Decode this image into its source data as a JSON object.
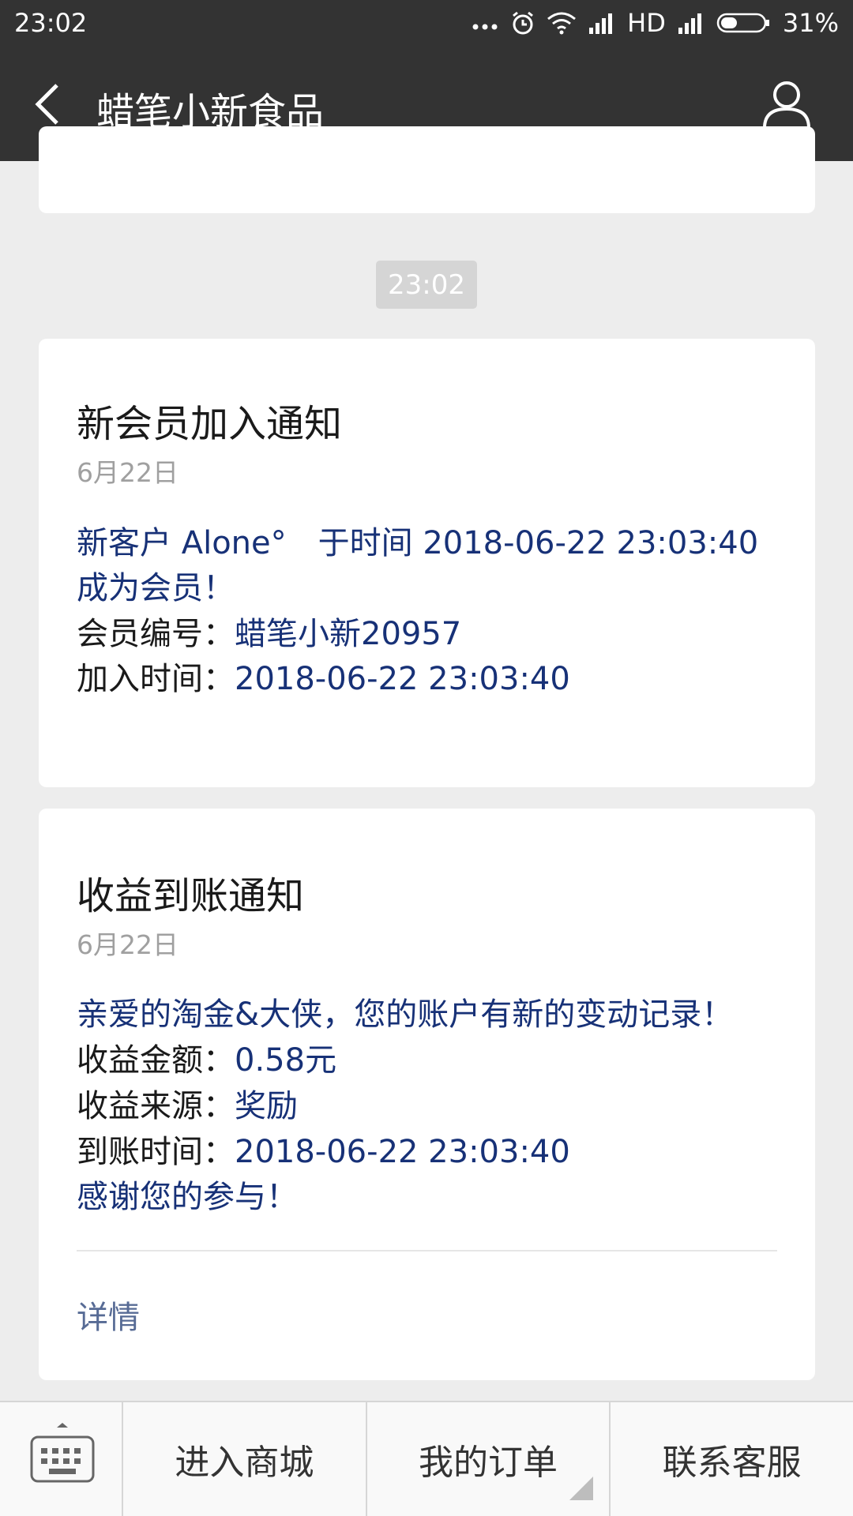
{
  "status_bar": {
    "time": "23:02",
    "network": "HD",
    "battery": "31%"
  },
  "header": {
    "title": "蜡笔小新食品"
  },
  "timestamp": "23:02",
  "cards": [
    {
      "title": "新会员加入通知",
      "date": "6月22日",
      "line1": "新客户 Alone°　于时间 2018-06-22 23:03:40",
      "line2": "成为会员！",
      "member_id_label": "会员编号：",
      "member_id_value": "蜡笔小新20957",
      "join_time_label": "加入时间：",
      "join_time_value": "2018-06-22 23:03:40"
    },
    {
      "title": "收益到账通知",
      "date": "6月22日",
      "greeting": "亲爱的淘金&大侠，您的账户有新的变动记录！",
      "amount_label": "收益金额：",
      "amount_value": "0.58元",
      "source_label": "收益来源：",
      "source_value": "奖励",
      "arrival_label": "到账时间：",
      "arrival_value": "2018-06-22 23:03:40",
      "thanks": "感谢您的参与！",
      "detail_link": "详情"
    }
  ],
  "bottom_menu": {
    "items": [
      "进入商城",
      "我的订单",
      "联系客服"
    ]
  },
  "icons": {
    "back": "back-arrow-icon",
    "profile": "user-profile-icon",
    "keyboard": "keyboard-icon"
  },
  "colors": {
    "header_bg": "#333333",
    "page_bg": "#ededed",
    "value_blue": "#173177",
    "link_blue": "#576b95"
  }
}
